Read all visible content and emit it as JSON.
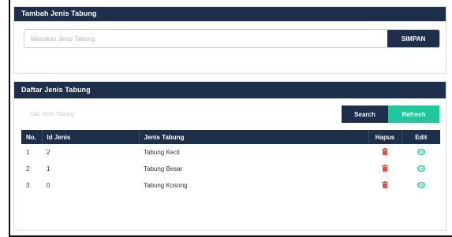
{
  "form_panel": {
    "title": "Tambah Jenis Tabung",
    "input_placeholder": "Masukan Jenis Tabung",
    "save_label": "SIMPAN"
  },
  "list_panel": {
    "title": "Daftar Jenis Tabung",
    "search_placeholder": "Cari Jenis Tabung",
    "search_label": "Search",
    "refresh_label": "Refresh",
    "columns": [
      "No.",
      "Id Jenis",
      "Jenis Tabung",
      "Hapus",
      "Edit"
    ],
    "rows": [
      {
        "no": "1",
        "id": "2",
        "jenis": "Tabung Kecil"
      },
      {
        "no": "2",
        "id": "1",
        "jenis": "Tabung Besar"
      },
      {
        "no": "3",
        "id": "0",
        "jenis": "Tabung Kosong"
      }
    ],
    "icons": {
      "delete": "trash-icon",
      "edit": "edit-icon"
    }
  },
  "colors": {
    "header": "#1d2f4b",
    "accent_green": "#1fc89a",
    "delete_red": "#e2504c",
    "edit_teal": "#1fc89a"
  }
}
